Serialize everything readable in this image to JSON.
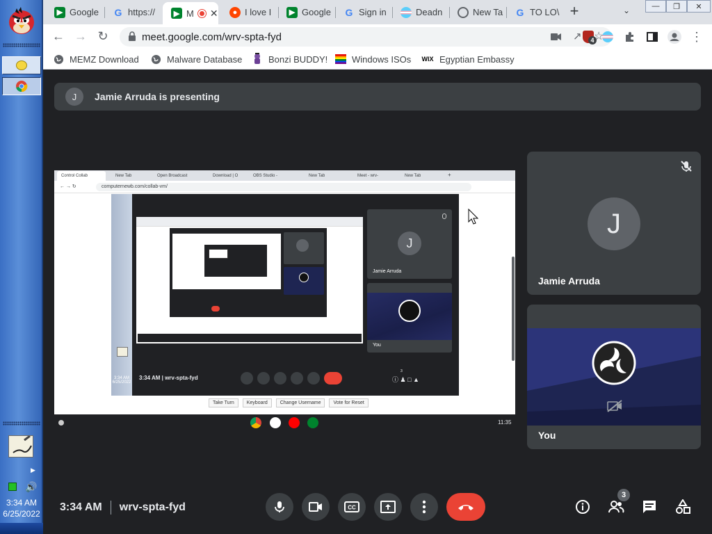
{
  "taskbar": {
    "clock_time": "3:34 AM",
    "clock_date": "6/25/2022",
    "buttons": [
      {
        "icon": "angry-bird-icon"
      },
      {
        "icon": "window-app-icon"
      },
      {
        "icon": "chrome-icon"
      }
    ]
  },
  "browser": {
    "tabs": [
      {
        "label": "Google",
        "icon": "google-meet-icon"
      },
      {
        "label": "https://",
        "icon": "google-icon"
      },
      {
        "label": "M",
        "icon": "google-meet-icon",
        "active": true
      },
      {
        "label": "I love I",
        "icon": "reddit-icon"
      },
      {
        "label": "Google",
        "icon": "google-meet-icon"
      },
      {
        "label": "Sign in",
        "icon": "google-icon"
      },
      {
        "label": "Deadn",
        "icon": "trans-flag-icon"
      },
      {
        "label": "New Ta",
        "icon": "chrome-icon"
      },
      {
        "label": "TO LO\\",
        "icon": "google-icon"
      }
    ],
    "url": "meet.google.com/wrv-spta-fyd",
    "extension_badge": "4",
    "bookmarks": [
      {
        "label": "MEMZ Download",
        "icon": "globe-icon"
      },
      {
        "label": "Malware Database",
        "icon": "globe-icon"
      },
      {
        "label": "Bonzi BUDDY!",
        "icon": "bonzi-icon"
      },
      {
        "label": "Windows ISOs",
        "icon": "rainbow-flag-icon"
      },
      {
        "label": "Egyptian Embassy",
        "icon": "wix-icon",
        "icon_text": "WIX"
      }
    ]
  },
  "meet": {
    "presenting_text": "Jamie Arruda is presenting",
    "presenter_initial": "J",
    "participants": [
      {
        "name": "Jamie Arruda",
        "initial": "J",
        "muted": true
      },
      {
        "name": "You",
        "camera_off": true
      }
    ],
    "bottom": {
      "time": "3:34 AM",
      "meeting_code": "wrv-spta-fyd",
      "people_count": "3"
    },
    "nested": {
      "tabs": [
        "Control Collab",
        "New Tab",
        "Open Broadcast",
        "Download | O",
        "OBS Studio -",
        "New Tab",
        "Meet - wrv-",
        "New Tab"
      ],
      "url": "computernewb.com/collab-vm/",
      "participant_name": "Jamie Arruda",
      "participant_initial": "J",
      "you_label": "You",
      "time": "3:34 AM",
      "meeting_code": "wrv-spta-fyd",
      "people_count": "3",
      "buttons": [
        "Take Turn",
        "Keyboard",
        "Change Username",
        "Vote for Reset"
      ],
      "shelf_time": "11:35",
      "mini_clock_time": "3:34 AM",
      "mini_clock_date": "6/25/2022"
    }
  },
  "colors": {
    "meet_bg": "#202124",
    "tile_bg": "#3c4043",
    "end_call": "#ea4335",
    "taskbar_blue": "#3a6fc4"
  }
}
